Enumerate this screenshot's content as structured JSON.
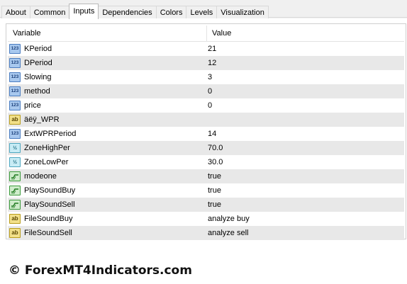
{
  "tabs": [
    "About",
    "Common",
    "Inputs",
    "Dependencies",
    "Colors",
    "Levels",
    "Visualization"
  ],
  "active_tab": "Inputs",
  "table": {
    "headers": {
      "variable": "Variable",
      "value": "Value"
    },
    "rows": [
      {
        "icon": "int-icon",
        "icon_text": "123",
        "variable": "KPeriod",
        "value": "21"
      },
      {
        "icon": "int-icon",
        "icon_text": "123",
        "variable": "DPeriod",
        "value": "12"
      },
      {
        "icon": "int-icon",
        "icon_text": "123",
        "variable": "Slowing",
        "value": "3"
      },
      {
        "icon": "int-icon",
        "icon_text": "123",
        "variable": "method",
        "value": "0"
      },
      {
        "icon": "int-icon",
        "icon_text": "123",
        "variable": "price",
        "value": "0"
      },
      {
        "icon": "string-icon",
        "icon_text": "ab",
        "variable": "äëÿ_WPR",
        "value": ""
      },
      {
        "icon": "int-icon",
        "icon_text": "123",
        "variable": "ExtWPRPeriod",
        "value": "14"
      },
      {
        "icon": "double-icon",
        "icon_text": "½",
        "variable": "ZoneHighPer",
        "value": "70.0"
      },
      {
        "icon": "double-icon",
        "icon_text": "½",
        "variable": "ZoneLowPer",
        "value": "30.0"
      },
      {
        "icon": "bool-icon",
        "icon_text": "",
        "variable": "modeone",
        "value": "true"
      },
      {
        "icon": "bool-icon",
        "icon_text": "",
        "variable": "PlaySoundBuy",
        "value": "true"
      },
      {
        "icon": "bool-icon",
        "icon_text": "",
        "variable": "PlaySoundSell",
        "value": "true"
      },
      {
        "icon": "string-icon",
        "icon_text": "ab",
        "variable": "FileSoundBuy",
        "value": "analyze buy"
      },
      {
        "icon": "string-icon",
        "icon_text": "ab",
        "variable": "FileSoundSell",
        "value": "analyze sell"
      }
    ]
  },
  "watermark": "© ForexMT4Indicators.com"
}
